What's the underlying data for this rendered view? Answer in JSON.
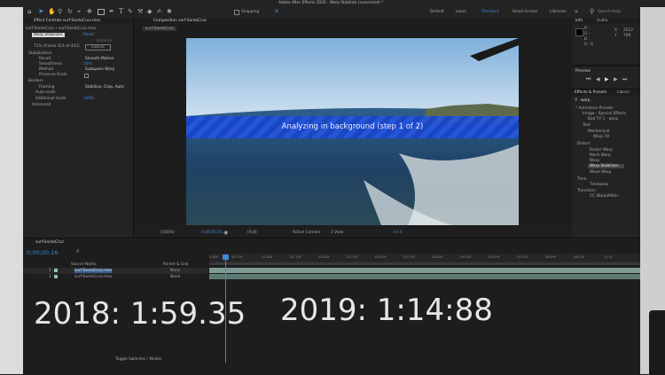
{
  "app": {
    "title": "Adobe After Effects 2020 - Warp Stabilize (converted) *",
    "workspaces": [
      "Default",
      "Learn",
      "Standard",
      "Small Screen",
      "Libraries"
    ],
    "active_workspace": "Standard",
    "snapping_label": "Snapping",
    "search_placeholder": "Search Help"
  },
  "effect_controls": {
    "tab": "Effect Controls surf-SantaCruz.mov",
    "comp_path": "surf-SantaCruz • surf-SantaCruz.mov",
    "effect_name": "Warp Stabilizer",
    "reset_label": "Reset",
    "stabilize_label": "Stabilize",
    "cancel_label": "Cancel",
    "progress_text": "71% (frame 314 of 443)",
    "params": [
      {
        "label": "Stabilization",
        "value": ""
      },
      {
        "label": "Result",
        "value": "Smooth Motion"
      },
      {
        "label": "Smoothness",
        "value": "50%"
      },
      {
        "label": "Method",
        "value": "Subspace Warp"
      },
      {
        "label": "Preserve Scale",
        "value": ""
      },
      {
        "label": "Borders",
        "value": ""
      },
      {
        "label": "Framing",
        "value": "Stabilize, Crop, Auto"
      },
      {
        "label": "Auto-scale",
        "value": ""
      },
      {
        "label": "Additional Scale",
        "value": "100%"
      },
      {
        "label": "Advanced",
        "value": ""
      }
    ]
  },
  "composition": {
    "tab": "Composition surf-SantaCruz",
    "subtab": "surf-SantaCruz",
    "overlay_text": "Analyzing in background (step 1 of 2)",
    "zoom": "(100%)",
    "timecode": "0;00;00;16",
    "resolution": "(Full)",
    "camera": "Active Camera",
    "views": "1 View",
    "exposure": "+0.0"
  },
  "info_panel": {
    "tabs": [
      "Info",
      "Audio"
    ],
    "x_label": "X",
    "x_value": "2212",
    "y_label": "Y",
    "y_value": "709",
    "r_label": "R :",
    "g_label": "G :",
    "b_label": "B :",
    "a_label": "A : 0"
  },
  "preview": {
    "title": "Preview"
  },
  "effects_presets": {
    "tabs": [
      "Effects & Presets",
      "Librari"
    ],
    "search_value": "warp",
    "items": [
      {
        "label": "* Animation Presets",
        "indent": 0
      },
      {
        "label": "Image - Special Effects",
        "indent": 1
      },
      {
        "label": "Bad TV 1 - warp",
        "indent": 2
      },
      {
        "label": "Text",
        "indent": 1
      },
      {
        "label": "Mechanical",
        "indent": 2
      },
      {
        "label": "Warp Fill",
        "indent": 3
      },
      {
        "label": "Distort",
        "indent": 0
      },
      {
        "label": "Bezier Warp",
        "indent": 1
      },
      {
        "label": "Mesh Warp",
        "indent": 1
      },
      {
        "label": "Warp",
        "indent": 1
      },
      {
        "label": "Warp Stabilizer",
        "indent": 1,
        "selected": true
      },
      {
        "label": "Wave Warp",
        "indent": 1
      },
      {
        "label": "Time",
        "indent": 0
      },
      {
        "label": "Timewarp",
        "indent": 1
      },
      {
        "label": "Transition",
        "indent": 0
      },
      {
        "label": "CC WarpoMatic",
        "indent": 1
      }
    ]
  },
  "timeline": {
    "tab": "surf-SantaCruz",
    "timecode": "0;00;00;16",
    "timecode_sub": "00016 (29.97 fps)",
    "col_source": "Source Name",
    "col_parent": "Parent & Link",
    "layers": [
      {
        "num": "1",
        "name": "surf-SantaCruz.mov",
        "parent": "None"
      },
      {
        "num": "2",
        "name": "surf-SantaCruz.mov",
        "parent": "None"
      }
    ],
    "ruler": [
      "0:00f",
      "00:15f",
      "01:00f",
      "01:15f",
      "02:00f",
      "02:15f",
      "03:00f",
      "03:15f",
      "04:00f",
      "04:15f",
      "05:00f",
      "05:15f",
      "06:00f",
      "06:15f",
      "07:0"
    ],
    "toggle_label": "Toggle Switches / Modes"
  },
  "overlay": {
    "left_caption": "2018: 1:59.35",
    "right_caption": "2019: 1:14:88"
  },
  "colors": {
    "accent": "#3f8ad8",
    "analyze_band": "#1f4fd6",
    "track": "#5d7a73",
    "bg": "#232323"
  }
}
